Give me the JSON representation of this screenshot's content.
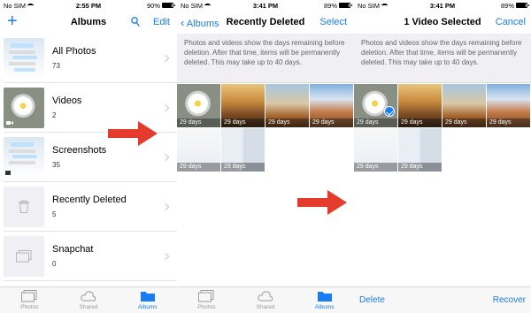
{
  "colors": {
    "accent": "#1a7cf5",
    "arrow": "#e53b2c"
  },
  "panel1": {
    "status": {
      "carrier": "No SIM",
      "time": "2:55 PM",
      "battery": "90%",
      "battery_level": 0.9
    },
    "nav": {
      "title": "Albums",
      "edit": "Edit"
    },
    "albums": [
      {
        "title": "All Photos",
        "count": "73"
      },
      {
        "title": "Videos",
        "count": "2"
      },
      {
        "title": "Screenshots",
        "count": "35"
      },
      {
        "title": "Recently Deleted",
        "count": "5"
      },
      {
        "title": "Snapchat",
        "count": "0"
      }
    ],
    "tabs": [
      {
        "label": "Photos",
        "icon": "photos-icon"
      },
      {
        "label": "Shared",
        "icon": "cloud-icon"
      },
      {
        "label": "Albums",
        "icon": "folder-icon"
      }
    ]
  },
  "panel2": {
    "status": {
      "carrier": "No SIM",
      "time": "3:41 PM",
      "battery": "89%",
      "battery_level": 0.89
    },
    "nav": {
      "back": "Albums",
      "title": "Recently Deleted",
      "select": "Select"
    },
    "info": "Photos and videos show the days remaining before deletion. After that time, items will be permanently deleted. This may take up to 40 days.",
    "days": [
      "29 days",
      "29 days",
      "29 days",
      "29 days",
      "29 days",
      "29 days"
    ],
    "tabs": [
      {
        "label": "Photos",
        "icon": "photos-icon"
      },
      {
        "label": "Shared",
        "icon": "cloud-icon"
      },
      {
        "label": "Albums",
        "icon": "folder-icon"
      }
    ]
  },
  "panel3": {
    "status": {
      "carrier": "No SIM",
      "time": "3:41 PM",
      "battery": "89%",
      "battery_level": 0.89
    },
    "nav": {
      "title": "1 Video Selected",
      "cancel": "Cancel"
    },
    "info": "Photos and videos show the days remaining before deletion. After that time, items will be permanently deleted. This may take up to 40 days.",
    "days": [
      "29 days",
      "29 days",
      "29 days",
      "29 days",
      "29 days",
      "29 days"
    ],
    "bottom": {
      "delete": "Delete",
      "recover": "Recover"
    }
  }
}
